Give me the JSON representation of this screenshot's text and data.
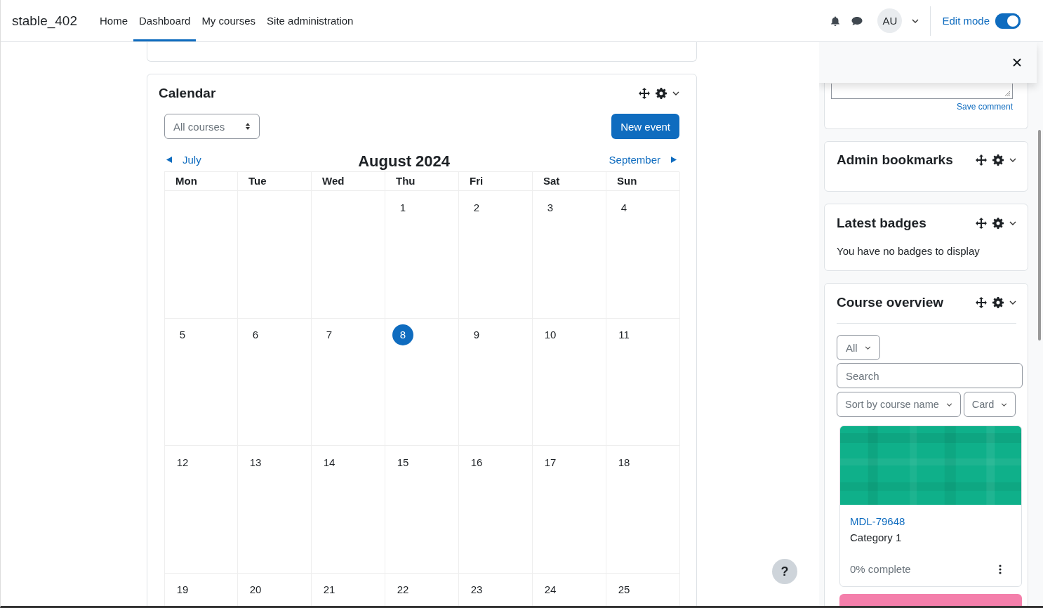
{
  "navbar": {
    "site_name": "stable_402",
    "items": [
      {
        "label": "Home",
        "selected": false
      },
      {
        "label": "Dashboard",
        "selected": true
      },
      {
        "label": "My courses",
        "selected": false
      },
      {
        "label": "Site administration",
        "selected": false
      }
    ],
    "avatar": "AU",
    "edit_mode": {
      "label": "Edit mode",
      "on": true
    }
  },
  "calendar": {
    "title": "Calendar",
    "filter": "All courses",
    "new_event": "New event",
    "prev": "July",
    "month": "August 2024",
    "next": "September",
    "weekdays": [
      "Mon",
      "Tue",
      "Wed",
      "Thu",
      "Fri",
      "Sat",
      "Sun"
    ],
    "weeks": [
      [
        {
          "kind": "blank"
        },
        {
          "kind": "blank"
        },
        {
          "kind": "blank"
        },
        {
          "kind": "day",
          "day": "1",
          "today": false
        },
        {
          "kind": "day",
          "day": "2",
          "today": false
        },
        {
          "kind": "day",
          "day": "3",
          "today": false
        },
        {
          "kind": "day",
          "day": "4",
          "today": false
        }
      ],
      [
        {
          "kind": "day",
          "day": "5",
          "today": false
        },
        {
          "kind": "day",
          "day": "6",
          "today": false
        },
        {
          "kind": "day",
          "day": "7",
          "today": false
        },
        {
          "kind": "day",
          "day": "8",
          "today": true
        },
        {
          "kind": "day",
          "day": "9",
          "today": false
        },
        {
          "kind": "day",
          "day": "10",
          "today": false
        },
        {
          "kind": "day",
          "day": "11",
          "today": false
        }
      ],
      [
        {
          "kind": "day",
          "day": "12",
          "today": false
        },
        {
          "kind": "day",
          "day": "13",
          "today": false
        },
        {
          "kind": "day",
          "day": "14",
          "today": false
        },
        {
          "kind": "day",
          "day": "15",
          "today": false
        },
        {
          "kind": "day",
          "day": "16",
          "today": false
        },
        {
          "kind": "day",
          "day": "17",
          "today": false
        },
        {
          "kind": "day",
          "day": "18",
          "today": false
        }
      ],
      [
        {
          "kind": "day",
          "day": "19",
          "today": false
        },
        {
          "kind": "day",
          "day": "20",
          "today": false
        },
        {
          "kind": "day",
          "day": "21",
          "today": false
        },
        {
          "kind": "day",
          "day": "22",
          "today": false
        },
        {
          "kind": "day",
          "day": "23",
          "today": false
        },
        {
          "kind": "day",
          "day": "24",
          "today": false
        },
        {
          "kind": "day",
          "day": "25",
          "today": false
        }
      ]
    ]
  },
  "help_button": "?",
  "drawer": {
    "save_comment": "Save comment",
    "blocks": [
      {
        "kind": "bookmarks",
        "title": "Admin bookmarks"
      },
      {
        "kind": "badges",
        "title": "Latest badges",
        "text": "You have no badges to display"
      },
      {
        "kind": "overview",
        "title": "Course overview",
        "filter": "All",
        "search_placeholder": "Search",
        "sort": "Sort by course name",
        "view": "Card",
        "courses": [
          {
            "name": "MDL-79648",
            "category": "Category 1",
            "progress": "0% complete",
            "color": "#0fb08a"
          }
        ]
      }
    ]
  }
}
